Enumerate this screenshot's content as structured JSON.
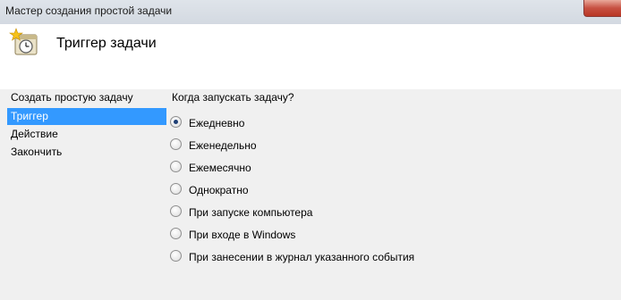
{
  "window": {
    "title": "Мастер создания простой задачи"
  },
  "header": {
    "title": "Триггер задачи",
    "icon": "task-scheduler-icon"
  },
  "steps": [
    {
      "label": "Создать простую задачу",
      "active": false
    },
    {
      "label": "Триггер",
      "active": true
    },
    {
      "label": "Действие",
      "active": false
    },
    {
      "label": "Закончить",
      "active": false
    }
  ],
  "trigger": {
    "question": "Когда запускать задачу?",
    "selected_index": 0,
    "options": [
      "Ежедневно",
      "Еженедельно",
      "Ежемесячно",
      "Однократно",
      "При запуске компьютера",
      "При входе в Windows",
      "При занесении в журнал указанного события"
    ]
  },
  "colors": {
    "selection": "#3399ff",
    "panel_bg": "#f0f0f0",
    "header_bg": "#ffffff",
    "close_button": "#c75042"
  }
}
